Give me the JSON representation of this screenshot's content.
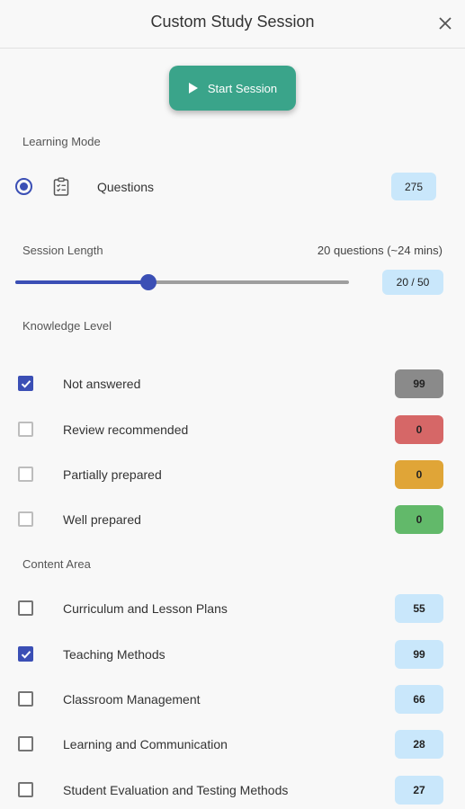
{
  "header": {
    "title": "Custom Study Session"
  },
  "start_button": {
    "label": "Start Session"
  },
  "learning_mode": {
    "section_label": "Learning Mode",
    "option_label": "Questions",
    "count": "275"
  },
  "session_length": {
    "section_label": "Session Length",
    "info": "20 questions (~24 mins)",
    "value_text": "20 / 50",
    "value": 20,
    "max": 50
  },
  "knowledge_level": {
    "section_label": "Knowledge Level",
    "items": [
      {
        "label": "Not answered",
        "count": "99",
        "checked": true,
        "color": "#8a8a8a"
      },
      {
        "label": "Review recommended",
        "count": "0",
        "checked": false,
        "color": "#d66767"
      },
      {
        "label": "Partially prepared",
        "count": "0",
        "checked": false,
        "color": "#e0a537"
      },
      {
        "label": "Well prepared",
        "count": "0",
        "checked": false,
        "color": "#62b96a"
      }
    ]
  },
  "content_area": {
    "section_label": "Content Area",
    "items": [
      {
        "label": "Curriculum and Lesson Plans",
        "count": "55",
        "checked": false
      },
      {
        "label": "Teaching Methods",
        "count": "99",
        "checked": true
      },
      {
        "label": "Classroom Management",
        "count": "66",
        "checked": false
      },
      {
        "label": "Learning and Communication",
        "count": "28",
        "checked": false
      },
      {
        "label": "Student Evaluation and Testing Methods",
        "count": "27",
        "checked": false
      }
    ]
  },
  "colors": {
    "accent": "#3b4fb5",
    "start_button": "#3aa48a",
    "count_pill": "#c9e7fb"
  }
}
